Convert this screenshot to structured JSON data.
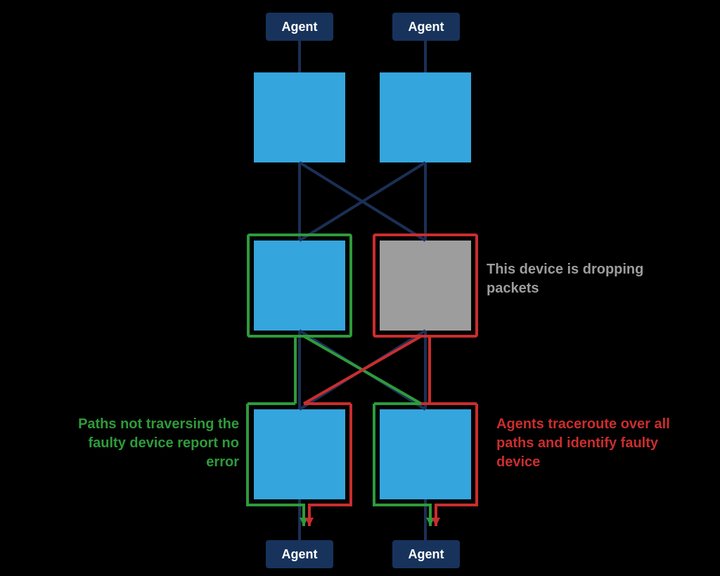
{
  "agents": {
    "top_left": "Agent",
    "top_right": "Agent",
    "bottom_left": "Agent",
    "bottom_right": "Agent"
  },
  "labels": {
    "faulty_device": "This device is dropping packets",
    "green_path": "Paths not traversing the faulty device report no error",
    "red_path": "Agents traceroute over all paths and identify faulty device"
  },
  "colors": {
    "agent_bg": "#17335c",
    "node_bg": "#35a5dd",
    "faulty_bg": "#9d9d9d",
    "link": "#1b2f56",
    "green": "#2e9b3b",
    "red": "#cb2d2e",
    "gray_text": "#9d9d9d"
  },
  "diagram_data": {
    "type": "network",
    "agents": [
      "top_left",
      "top_right",
      "bottom_left",
      "bottom_right"
    ],
    "nodes": [
      {
        "id": "R1L",
        "row": 1,
        "col": "left",
        "faulty": false
      },
      {
        "id": "R1R",
        "row": 1,
        "col": "right",
        "faulty": false
      },
      {
        "id": "R2L",
        "row": 2,
        "col": "left",
        "faulty": false
      },
      {
        "id": "R2R",
        "row": 2,
        "col": "right",
        "faulty": true
      },
      {
        "id": "R3L",
        "row": 3,
        "col": "left",
        "faulty": false
      },
      {
        "id": "R3R",
        "row": 3,
        "col": "right",
        "faulty": false
      }
    ],
    "links": [
      [
        "R1L",
        "R2L"
      ],
      [
        "R1L",
        "R2R"
      ],
      [
        "R1R",
        "R2L"
      ],
      [
        "R1R",
        "R2R"
      ],
      [
        "R2L",
        "R3L"
      ],
      [
        "R2L",
        "R3R"
      ],
      [
        "R2R",
        "R3L"
      ],
      [
        "R2R",
        "R3R"
      ]
    ],
    "traced_paths": {
      "green_ok": [
        [
          "R2L",
          "R3L"
        ],
        [
          "R2L",
          "R3R"
        ]
      ],
      "red_faulty": [
        [
          "R2R",
          "R3L"
        ],
        [
          "R2R",
          "R3R"
        ]
      ]
    }
  }
}
